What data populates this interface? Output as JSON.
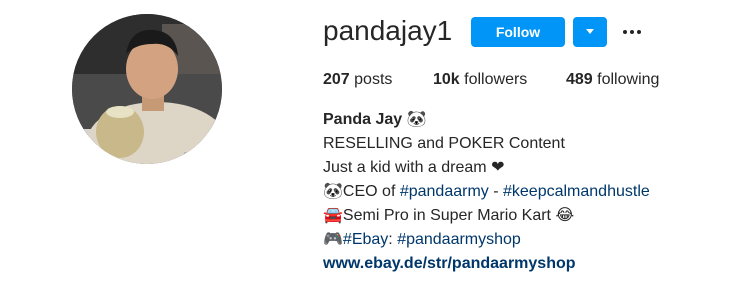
{
  "profile": {
    "username": "pandajay1",
    "follow_label": "Follow",
    "stats": {
      "posts_count": "207",
      "posts_label": "posts",
      "followers_count": "10k",
      "followers_label": "followers",
      "following_count": "489",
      "following_label": "following"
    },
    "bio": {
      "name": "Panda Jay 🐼",
      "line1": "RESELLING and POKER Content",
      "line2": "Just a kid with a dream ❤",
      "line3_prefix": "🐼CEO of ",
      "line3_tag1": "#pandaarmy",
      "line3_sep": " - ",
      "line3_tag2": "#keepcalmandhustle",
      "line4": "🚘Semi Pro in Super Mario Kart 😂",
      "line5_tag1": "🎮#Ebay",
      "line5_sep": ": ",
      "line5_tag2": "#pandaarmyshop",
      "website": "www.ebay.de/str/pandaarmyshop"
    }
  },
  "colors": {
    "accent": "#0095f6",
    "link": "#00376b",
    "text": "#262626"
  },
  "icons": {
    "dropdown": "chevron-down-icon",
    "more": "more-options-icon"
  }
}
